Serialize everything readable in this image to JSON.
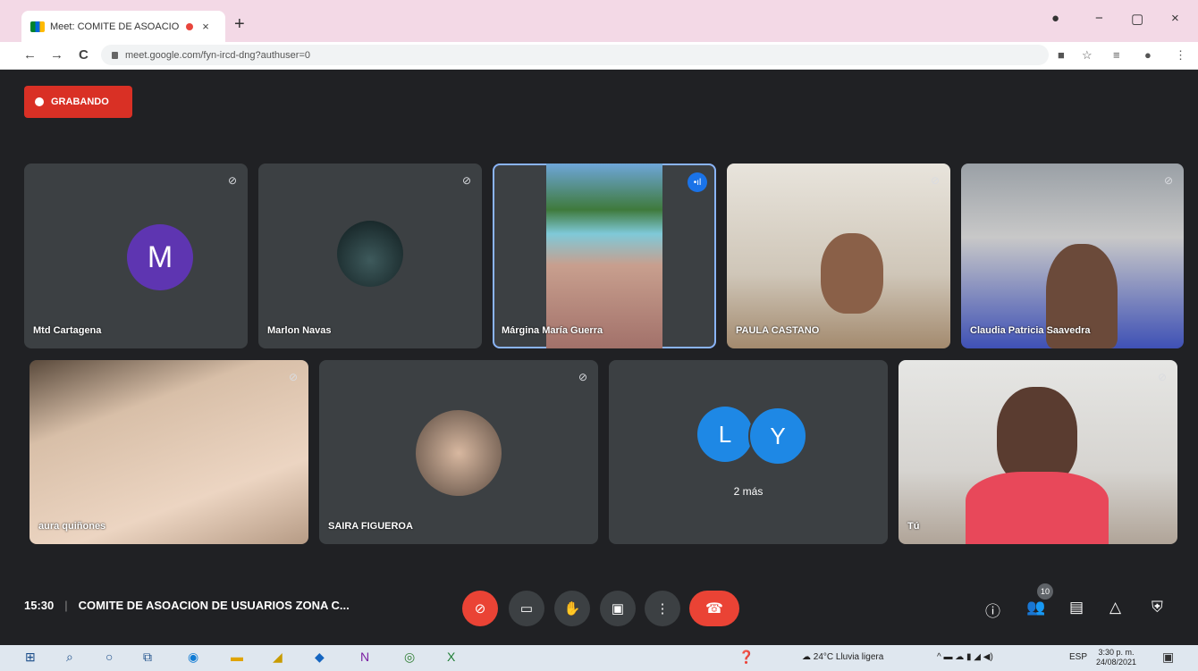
{
  "browser": {
    "tab_title": "Meet: COMITE DE ASOACIO",
    "tab_close": "×",
    "new_tab": "+",
    "url": "meet.google.com/fyn-ircd-dng?authuser=0",
    "nav_back": "←",
    "nav_forward": "→",
    "nav_reload": "C",
    "win_minimize": "−",
    "win_restore": "▢",
    "win_close": "×"
  },
  "meet": {
    "recording_label": "GRABANDO",
    "tiles": [
      {
        "name": "Mtd Cartagena",
        "avatar_letter": "M"
      },
      {
        "name": "Marlon Navas"
      },
      {
        "name": "Márgina María Guerra"
      },
      {
        "name": "PAULA CASTANO"
      },
      {
        "name": "Claudia Patricia Saavedra"
      },
      {
        "name": "aura quiñones"
      },
      {
        "name": "SAIRA FIGUEROA"
      },
      {
        "name": "2 más",
        "avatar_letters": [
          "L",
          "Y"
        ]
      },
      {
        "name": "Tú"
      }
    ],
    "time": "15:30",
    "separator": "|",
    "meeting_title": "COMITE DE ASOACION DE USUARIOS ZONA C...",
    "participants_count": "10"
  },
  "taskbar": {
    "weather": "24°C  Lluvia ligera",
    "language": "ESP",
    "clock_time": "3:30 p. m.",
    "clock_date": "24/08/2021"
  },
  "colors": {
    "accent": "#1a73e8",
    "recording": "#d93025",
    "end_call": "#ea4335",
    "avatar_m": "#5e35b1",
    "avatar_ly": "#1e88e5"
  }
}
